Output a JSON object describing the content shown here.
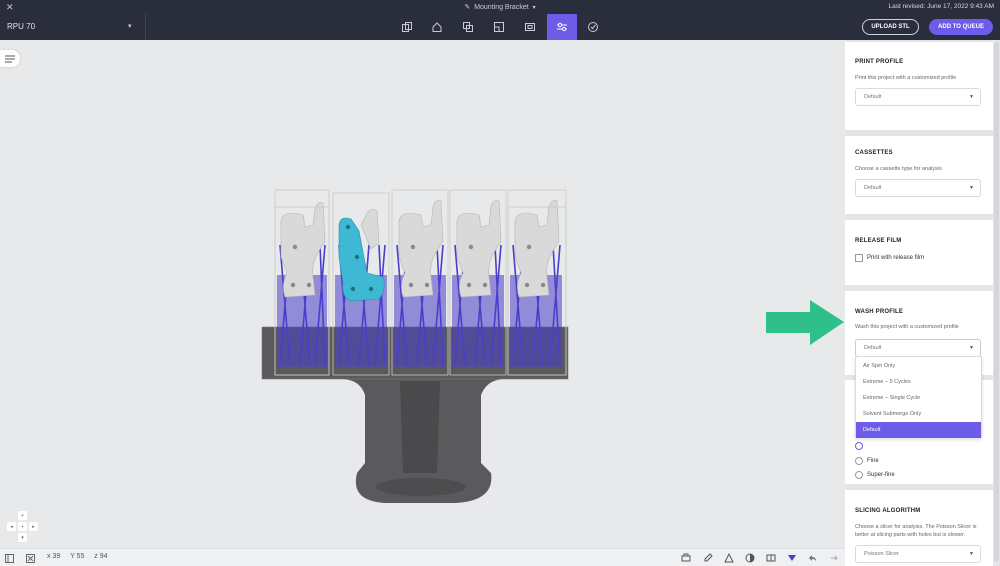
{
  "window": {
    "title": "Mounting Bracket",
    "last_revised": "Last revised: June 17, 2022 9:43 AM",
    "close_icon": "close-icon"
  },
  "toolbar": {
    "printer": "RPU 70",
    "upload_label": "UPLOAD STL",
    "queue_label": "ADD TO QUEUE",
    "accent": "#6c5ce7",
    "tools": [
      "copy-icon",
      "home-icon",
      "duplicate-icon",
      "layout-icon",
      "resolution-icon",
      "settings-sliders-icon",
      "check-circle-icon"
    ],
    "active_tool": "settings-sliders-icon"
  },
  "status": {
    "x": "x 39",
    "y": "Y 55",
    "z": "z 94"
  },
  "panel": {
    "print_profile": {
      "title": "PRINT PROFILE",
      "desc": "Print this project with a customized profile",
      "value": "Default"
    },
    "cassettes": {
      "title": "CASSETTES",
      "desc": "Choose a cassette type for analysis",
      "value": "Default"
    },
    "release_film": {
      "title": "RELEASE FILM",
      "checkbox_label": "Print with release film",
      "checked": false
    },
    "wash_profile": {
      "title": "WASH PROFILE",
      "desc": "Wash this project with a customized profile",
      "value": "Default",
      "options": [
        "Air Spin Only",
        "Extreme – 5 Cycles",
        "Extreme – Single Cycle",
        "Solvent Submerge Only",
        "Default"
      ],
      "selected_option": "Default"
    },
    "resolution": {
      "options": [
        "Fine",
        "Super-fine"
      ]
    },
    "slicing": {
      "title": "SLICING ALGORITHM",
      "desc": "Choose a slicer for analysis. The Poisson Slicer is better at slicing parts with holes but is slower.",
      "value": "Poisson Slicer"
    }
  },
  "colors": {
    "topbar": "#2a2d3c",
    "support": "#4b3fc9",
    "part": "#d8d8d8",
    "selected_part": "#3fb8d3",
    "build_plate": "#555555",
    "arrow": "#2fbf8a"
  }
}
